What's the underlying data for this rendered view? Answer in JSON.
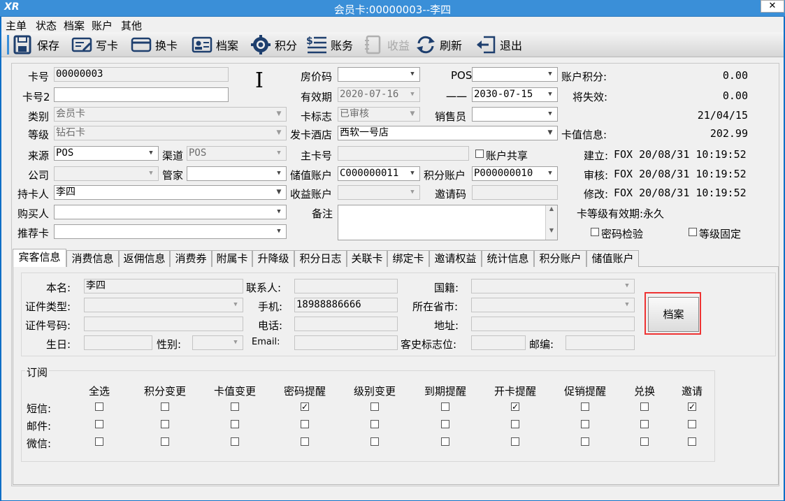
{
  "window": {
    "title": "会员卡:00000003--李四",
    "logo": "XR",
    "close": "✕"
  },
  "menu": [
    "主单",
    "状态",
    "档案",
    "账户",
    "其他"
  ],
  "toolbar": {
    "save": "保存",
    "write_card": "写卡",
    "change_card": "换卡",
    "archive": "档案",
    "points": "积分",
    "accounts": "账务",
    "income": "收益",
    "refresh": "刷新",
    "exit": "退出"
  },
  "form": {
    "card_no_label": "卡号",
    "card_no": "00000003",
    "card_no2_label": "卡号2",
    "card_no2": "",
    "category_label": "类别",
    "category": "会员卡",
    "level_label": "等级",
    "level": "钻石卡",
    "source_label": "来源",
    "source": "POS",
    "channel_label": "渠道",
    "channel": "POS",
    "company_label": "公司",
    "company": "",
    "butler_label": "管家",
    "butler": "",
    "holder_label": "持卡人",
    "holder": "李四",
    "buyer_label": "购买人",
    "buyer": "",
    "referrer_label": "推荐卡",
    "referrer": "",
    "room_code_label": "房价码",
    "room_code": "",
    "pos_label": "POS",
    "pos": "",
    "valid_label": "有效期",
    "valid_from": "2020-07-16",
    "dash": "一一",
    "valid_to": "2030-07-15",
    "card_flag_label": "卡标志",
    "card_flag": "已审核",
    "sales_label": "销售员",
    "sales": "",
    "hotel_label": "发卡酒店",
    "hotel": "西软一号店",
    "main_card_label": "主卡号",
    "main_card": "",
    "share_label": "账户共享",
    "stored_acct_label": "储值账户",
    "stored_acct": "C000000011",
    "points_acct_label": "积分账户",
    "points_acct": "P000000010",
    "income_acct_label": "收益账户",
    "income_acct": "",
    "invite_label": "邀请码",
    "invite": "",
    "remark_label": "备注",
    "remark": ""
  },
  "info": {
    "points_label": "账户积分:",
    "points": "0.00",
    "expire_label": "将失效:",
    "expire": "0.00",
    "date": "21/04/15",
    "stored_label": "卡值信息:",
    "stored": "202.99",
    "created_label": "建立:",
    "created": "FOX    20/08/31 10:19:52",
    "audit_label": "审核:",
    "audit": "FOX    20/08/31 10:19:52",
    "modified_label": "修改:",
    "modified": "FOX    20/08/31 10:19:52",
    "level_valid": "卡等级有效期:永久",
    "pwd_check": "密码检验",
    "level_fixed": "等级固定"
  },
  "tabs": [
    "宾客信息",
    "消费信息",
    "返佣信息",
    "消费券",
    "附属卡",
    "升降级",
    "积分日志",
    "关联卡",
    "绑定卡",
    "邀请权益",
    "统计信息",
    "积分账户",
    "储值账户"
  ],
  "guest": {
    "name_label": "本名:",
    "name": "李四",
    "contact_label": "联系人:",
    "contact": "",
    "nation_label": "国籍:",
    "nation": "",
    "id_type_label": "证件类型:",
    "id_type": "",
    "mobile_label": "手机:",
    "mobile": "18988886666",
    "province_label": "所在省市:",
    "province": "",
    "id_no_label": "证件号码:",
    "id_no": "",
    "phone_label": "电话:",
    "phone": "",
    "address_label": "地址:",
    "address": "",
    "birthday_label": "生日:",
    "birthday": "",
    "gender_label": "性别:",
    "gender": "",
    "email_label": "Email:",
    "email": "",
    "history_label": "客史标志位:",
    "history": "",
    "zip_label": "邮编:",
    "zip": "",
    "archive_btn": "档案"
  },
  "subscribe": {
    "title": "订阅",
    "columns": [
      "全选",
      "积分变更",
      "卡值变更",
      "密码提醒",
      "级别变更",
      "到期提醒",
      "开卡提醒",
      "促销提醒",
      "兑换",
      "邀请"
    ],
    "rows": [
      {
        "label": "短信:",
        "checked": [
          false,
          false,
          false,
          true,
          false,
          false,
          true,
          false,
          false,
          true
        ]
      },
      {
        "label": "邮件:",
        "checked": [
          false,
          false,
          false,
          false,
          false,
          false,
          false,
          false,
          false,
          false
        ]
      },
      {
        "label": "微信:",
        "checked": [
          false,
          false,
          false,
          false,
          false,
          false,
          false,
          false,
          false,
          false
        ]
      }
    ]
  }
}
